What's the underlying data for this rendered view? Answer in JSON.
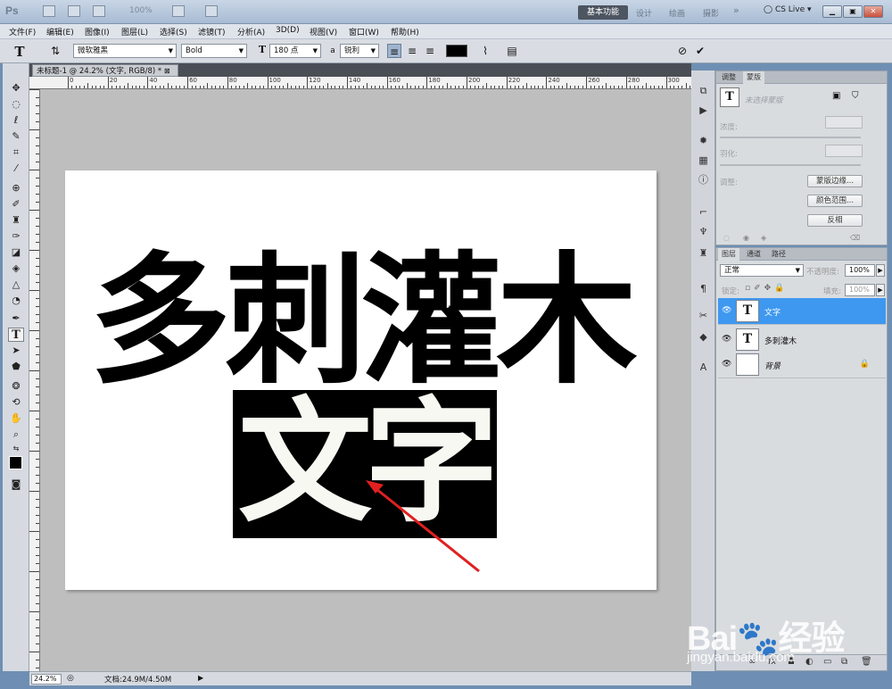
{
  "titlebar": {
    "app": "Ps",
    "zoom": "100%",
    "workspaces": [
      "基本功能",
      "设计",
      "绘画",
      "摄影"
    ],
    "more": "»",
    "cslive": "CS Live"
  },
  "menu": [
    "文件(F)",
    "编辑(E)",
    "图像(I)",
    "图层(L)",
    "选择(S)",
    "滤镜(T)",
    "分析(A)",
    "3D(D)",
    "视图(V)",
    "窗口(W)",
    "帮助(H)"
  ],
  "options": {
    "font_family": "微软雅黑",
    "font_style": "Bold",
    "font_size": "180 点",
    "aa_label": "a",
    "antialias": "锐利",
    "text_color": "#000000"
  },
  "document": {
    "tab_title": "未标题-1 @ 24.2% (文字, RGB/8) *",
    "line1": "多刺灌木",
    "line2": "文字"
  },
  "ruler_top": [
    "0",
    "20",
    "40",
    "60",
    "80",
    "100",
    "120",
    "140",
    "160",
    "180",
    "200",
    "220",
    "240",
    "260",
    "280",
    "300"
  ],
  "status": {
    "zoom": "24.2%",
    "docinfo": "文档:24.9M/4.50M"
  },
  "adjust_panel": {
    "tabs": [
      "调整",
      "蒙版"
    ],
    "hint": "未选择蒙版",
    "density": "浓度:",
    "feather": "羽化:",
    "adjust": "调整:",
    "btn_edge": "蒙版边缘...",
    "btn_range": "颜色范围...",
    "btn_invert": "反相"
  },
  "layers_panel": {
    "tabs": [
      "图层",
      "通道",
      "路径"
    ],
    "blend": "正常",
    "opacity_label": "不透明度:",
    "opacity": "100%",
    "lock_label": "锁定:",
    "fill_label": "填充:",
    "fill": "100%",
    "layers": [
      {
        "name": "文字",
        "thumb": "T",
        "active": true
      },
      {
        "name": "多刺灌木",
        "thumb": "T",
        "active": false
      },
      {
        "name": "背景",
        "thumb": "",
        "active": false
      }
    ]
  },
  "watermark": {
    "brand": "Bai",
    "brand2": "经验",
    "url": "jingyan.baidu.com"
  },
  "colors": {
    "selection_bg": "#000000",
    "active_layer": "#3e98f0",
    "arrow": "#e02020"
  }
}
